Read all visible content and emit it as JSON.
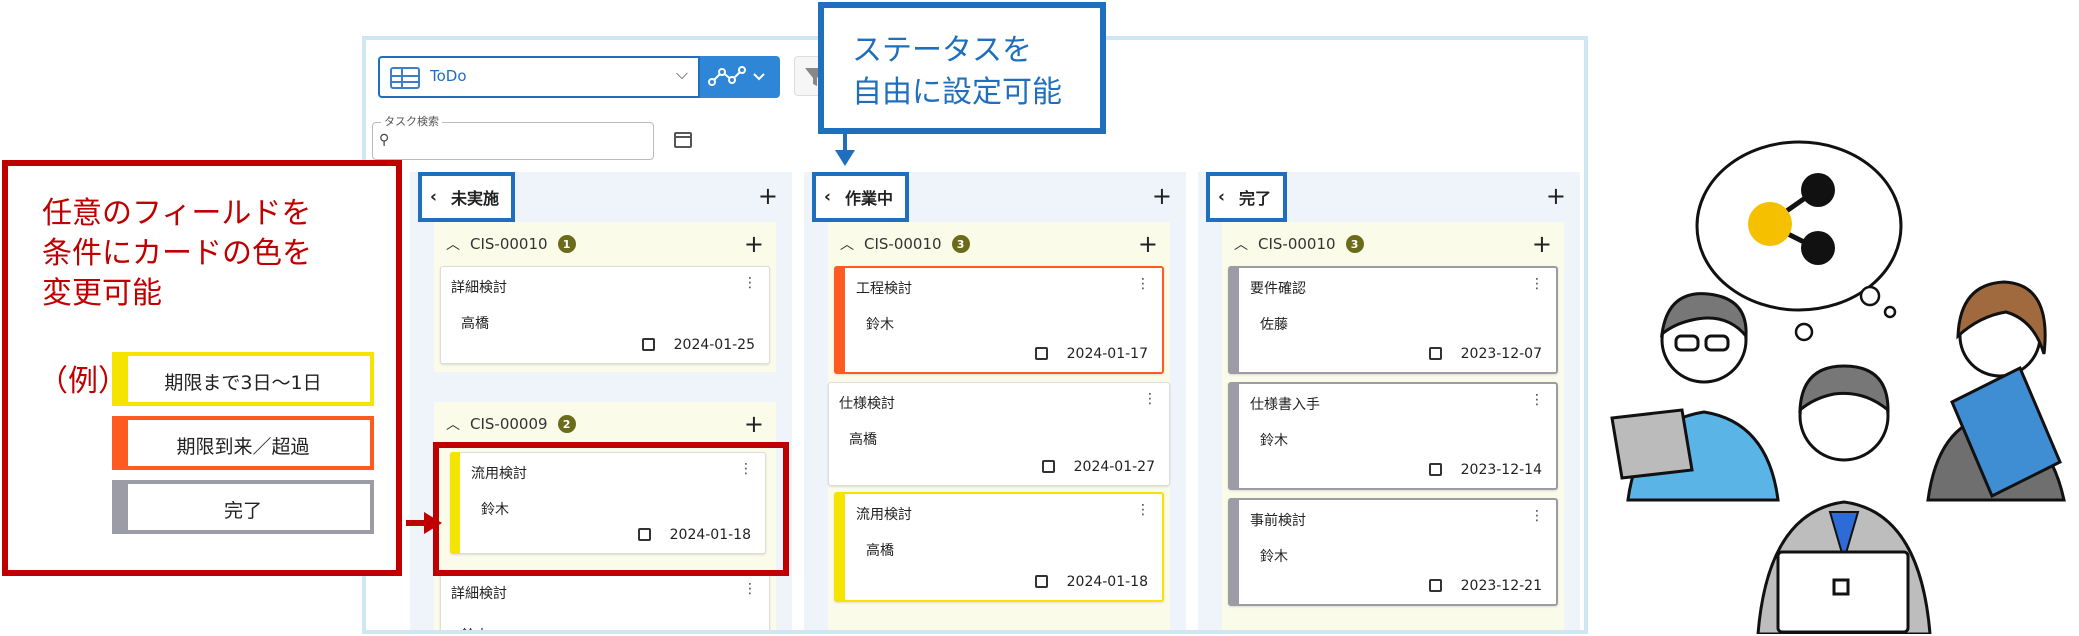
{
  "toolbar": {
    "view_label": "ToDo",
    "search_legend": "タスク検索"
  },
  "colors": {
    "status_blue": "#1f6fbe",
    "callout_red": "#c00000",
    "yellow": "#f5e400",
    "orange": "#ff5a1f",
    "gray": "#9c9ca6"
  },
  "columns": [
    {
      "title": "未実施",
      "groups": [
        {
          "id": "CIS-00010",
          "count": "1",
          "cards": [
            {
              "title": "詳細検討",
              "user": "高橋",
              "date": "2024-01-25",
              "color": "none"
            }
          ]
        },
        {
          "id": "CIS-00009",
          "count": "2",
          "cards": [
            {
              "title": "流用検討",
              "user": "鈴木",
              "date": "2024-01-18",
              "color": "yellow"
            },
            {
              "title": "詳細検討",
              "user": "鈴木",
              "date": "",
              "color": "none"
            }
          ]
        }
      ]
    },
    {
      "title": "作業中",
      "groups": [
        {
          "id": "CIS-00010",
          "count": "3",
          "cards": [
            {
              "title": "工程検討",
              "user": "鈴木",
              "date": "2024-01-17",
              "color": "orange"
            },
            {
              "title": "仕様検討",
              "user": "高橋",
              "date": "2024-01-27",
              "color": "none"
            },
            {
              "title": "流用検討",
              "user": "高橋",
              "date": "2024-01-18",
              "color": "yellow"
            }
          ]
        }
      ]
    },
    {
      "title": "完了",
      "groups": [
        {
          "id": "CIS-00010",
          "count": "3",
          "cards": [
            {
              "title": "要件確認",
              "user": "佐藤",
              "date": "2023-12-07",
              "color": "gray"
            },
            {
              "title": "仕様書入手",
              "user": "鈴木",
              "date": "2023-12-14",
              "color": "gray"
            },
            {
              "title": "事前検討",
              "user": "鈴木",
              "date": "2023-12-21",
              "color": "gray"
            }
          ]
        }
      ]
    }
  ],
  "callout_status": {
    "line1": "ステータスを",
    "line2": "自由に設定可能"
  },
  "callout_color": {
    "line1": "任意のフィールドを",
    "line2": "条件にカードの色を",
    "line3": "変更可能",
    "example": "（例）",
    "legend": [
      "期限まで3日〜1日",
      "期限到来／超過",
      "完了"
    ]
  }
}
